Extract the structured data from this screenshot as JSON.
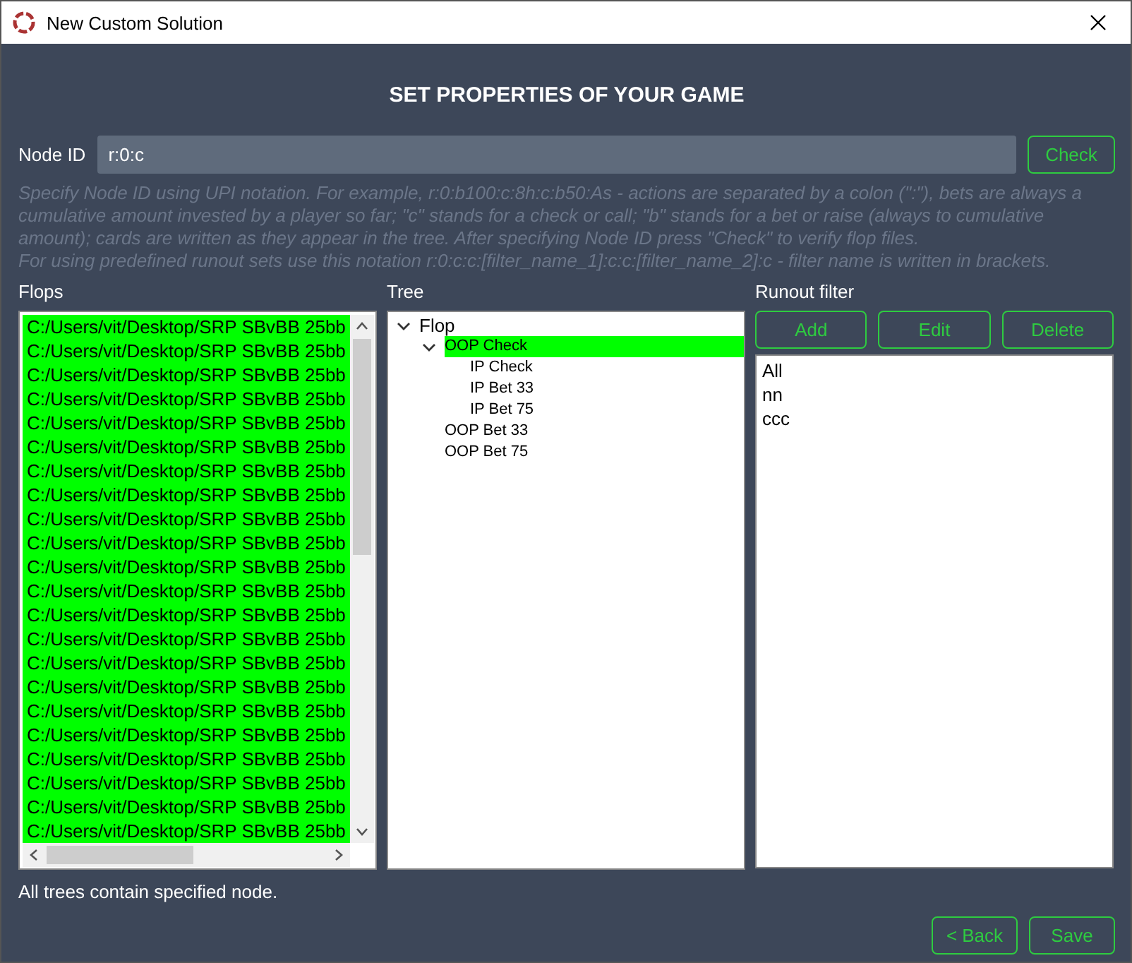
{
  "window": {
    "title": "New Custom Solution"
  },
  "heading": "SET PROPERTIES OF YOUR GAME",
  "node_id": {
    "label": "Node ID",
    "value": "r:0:c",
    "button": "Check"
  },
  "help": [
    "Specify Node ID using UPI notation. For example, r:0:b100:c:8h:c:b50:As - actions are separated by a colon (\":\"), bets are always a cumulative amount invested by a player so far; \"c\" stands for a check or call; \"b\" stands for a bet or raise (always to cumulative amount); cards are written as they appear in the tree. After specifying Node ID press \"Check\" to verify flop files.",
    "For using predefined runout sets use this notation r:0:c:c:[filter_name_1]:c:c:[filter_name_2]:c - filter name is written in brackets."
  ],
  "flops": {
    "title": "Flops",
    "rows": [
      {
        "text": "C:/Users/vit/Desktop/SRP SBvBB 25bb",
        "selected": true
      },
      {
        "text": "C:/Users/vit/Desktop/SRP SBvBB 25bb",
        "selected": true
      },
      {
        "text": "C:/Users/vit/Desktop/SRP SBvBB 25bb",
        "selected": true
      },
      {
        "text": "C:/Users/vit/Desktop/SRP SBvBB 25bb",
        "selected": true
      },
      {
        "text": "C:/Users/vit/Desktop/SRP SBvBB 25bb",
        "selected": true
      },
      {
        "text": "C:/Users/vit/Desktop/SRP SBvBB 25bb",
        "selected": true
      },
      {
        "text": "C:/Users/vit/Desktop/SRP SBvBB 25bb",
        "selected": true
      },
      {
        "text": "C:/Users/vit/Desktop/SRP SBvBB 25bb",
        "selected": true
      },
      {
        "text": "C:/Users/vit/Desktop/SRP SBvBB 25bb",
        "selected": true
      },
      {
        "text": "C:/Users/vit/Desktop/SRP SBvBB 25bb",
        "selected": true
      },
      {
        "text": "C:/Users/vit/Desktop/SRP SBvBB 25bb",
        "selected": true
      },
      {
        "text": "C:/Users/vit/Desktop/SRP SBvBB 25bb",
        "selected": true
      },
      {
        "text": "C:/Users/vit/Desktop/SRP SBvBB 25bb",
        "selected": true
      },
      {
        "text": "C:/Users/vit/Desktop/SRP SBvBB 25bb",
        "selected": true
      },
      {
        "text": "C:/Users/vit/Desktop/SRP SBvBB 25bb",
        "selected": true
      },
      {
        "text": "C:/Users/vit/Desktop/SRP SBvBB 25bb",
        "selected": true
      },
      {
        "text": "C:/Users/vit/Desktop/SRP SBvBB 25bb",
        "selected": true
      },
      {
        "text": "C:/Users/vit/Desktop/SRP SBvBB 25bb",
        "selected": true
      },
      {
        "text": "C:/Users/vit/Desktop/SRP SBvBB 25bb",
        "selected": true
      },
      {
        "text": "C:/Users/vit/Desktop/SRP SBvBB 25bb",
        "selected": true
      },
      {
        "text": "C:/Users/vit/Desktop/SRP SBvBB 25bb",
        "selected": true
      },
      {
        "text": "C:/Users/vit/Desktop/SRP SBvBB 25bb",
        "selected": true
      }
    ]
  },
  "tree": {
    "title": "Tree",
    "items": [
      {
        "label": "Flop",
        "expanded": true,
        "selected": false,
        "children": [
          {
            "label": "OOP Check",
            "expanded": true,
            "selected": true,
            "children": [
              {
                "label": "IP Check",
                "selected": false
              },
              {
                "label": "IP Bet 33",
                "selected": false
              },
              {
                "label": "IP Bet 75",
                "selected": false
              }
            ]
          },
          {
            "label": "OOP Bet 33",
            "selected": false
          },
          {
            "label": "OOP Bet 75",
            "selected": false
          }
        ]
      }
    ]
  },
  "runout_filter": {
    "title": "Runout filter",
    "buttons": [
      "Add",
      "Edit",
      "Delete"
    ],
    "items": [
      "All",
      "nn",
      "ccc"
    ]
  },
  "status": "All trees contain specified node.",
  "footer_buttons": [
    "< Back",
    "Save"
  ]
}
